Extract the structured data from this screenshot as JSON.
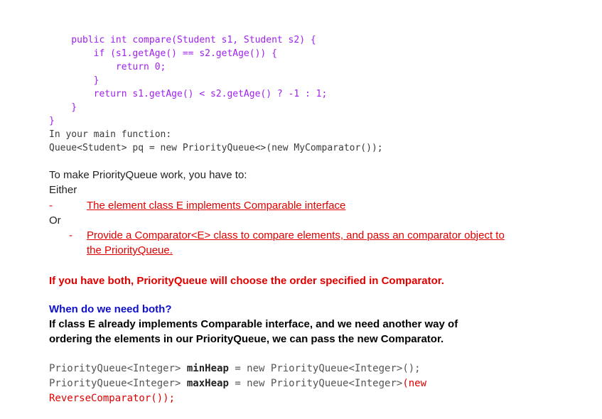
{
  "code_block": {
    "lines": [
      "    public int compare(Student s1, Student s2) {",
      "        if (s1.getAge() == s2.getAge()) {",
      "            return 0;",
      "        }",
      "        return s1.getAge() < s2.getAge() ? -1 : 1;",
      "    }",
      "}"
    ],
    "main_label": "In your main function:",
    "queue_line": "Queue<Student> pq = new PriorityQueue<>(new MyComparator());"
  },
  "body": {
    "intro": "To make PriorityQueue work, you have to:",
    "either": "Either",
    "option1_dash": "-",
    "option1": "The element class E implements Comparable interface",
    "or": "Or",
    "option2_dash": "-",
    "option2_line1": "Provide a Comparator<E> class to compare elements, and pass an comparator object to",
    "option2_line2": "the PriorityQueue.",
    "both_note": "If you have both, PriorityQueue will choose the order specified in Comparator.",
    "question": "When do we need both?",
    "answer_line1": "If class E already implements Comparable interface, and we need another way of",
    "answer_line2": "ordering the elements in our PriorityQueue, we can pass the new Comparator."
  },
  "bottom_code": {
    "line1_a": "PriorityQueue<Integer> ",
    "line1_var": "minHeap",
    "line1_b": " = new PriorityQueue<Integer>();",
    "line2_a": "PriorityQueue<Integer> ",
    "line2_var": "maxHeap",
    "line2_b": " = new PriorityQueue<Integer>",
    "line2_c": "(new",
    "line3": "ReverseComparator());"
  }
}
